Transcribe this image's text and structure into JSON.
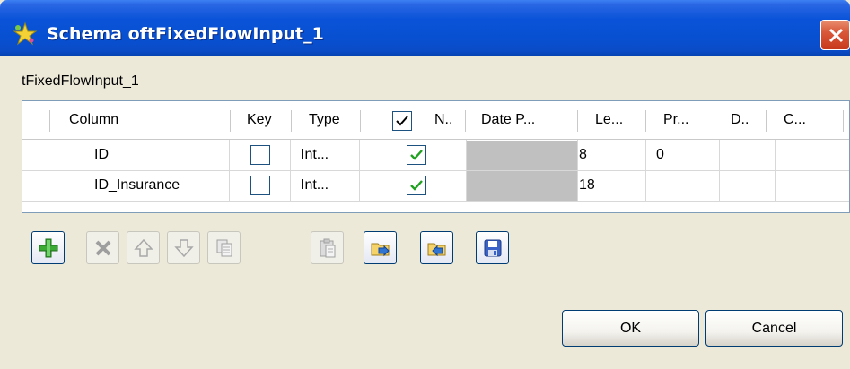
{
  "window": {
    "title": "Schema oftFixedFlowInput_1",
    "subtitle": "tFixedFlowInput_1"
  },
  "table": {
    "headers": {
      "column": "Column",
      "key": "Key",
      "type": "Type",
      "nullable": "N..",
      "date_pattern": "Date P...",
      "length": "Le...",
      "precision": "Pr...",
      "default": "D..",
      "comment": "C..."
    },
    "rows": [
      {
        "column": "ID",
        "key": false,
        "type": "Int...",
        "nullable": true,
        "length": "8",
        "precision": "0"
      },
      {
        "column": "ID_Insurance",
        "key": false,
        "type": "Int...",
        "nullable": true,
        "length": "18",
        "precision": ""
      }
    ]
  },
  "toolbar": {
    "icons": [
      "add-icon",
      "delete-icon",
      "move-up-icon",
      "move-down-icon",
      "copy-icon",
      "paste-icon",
      "import-icon",
      "export-icon",
      "save-icon"
    ]
  },
  "buttons": {
    "ok": "OK",
    "cancel": "Cancel"
  },
  "colors": {
    "titlebar": "#0a53d8",
    "close": "#d9583b",
    "dialog_bg": "#ece9d8",
    "check": "#21a121"
  }
}
